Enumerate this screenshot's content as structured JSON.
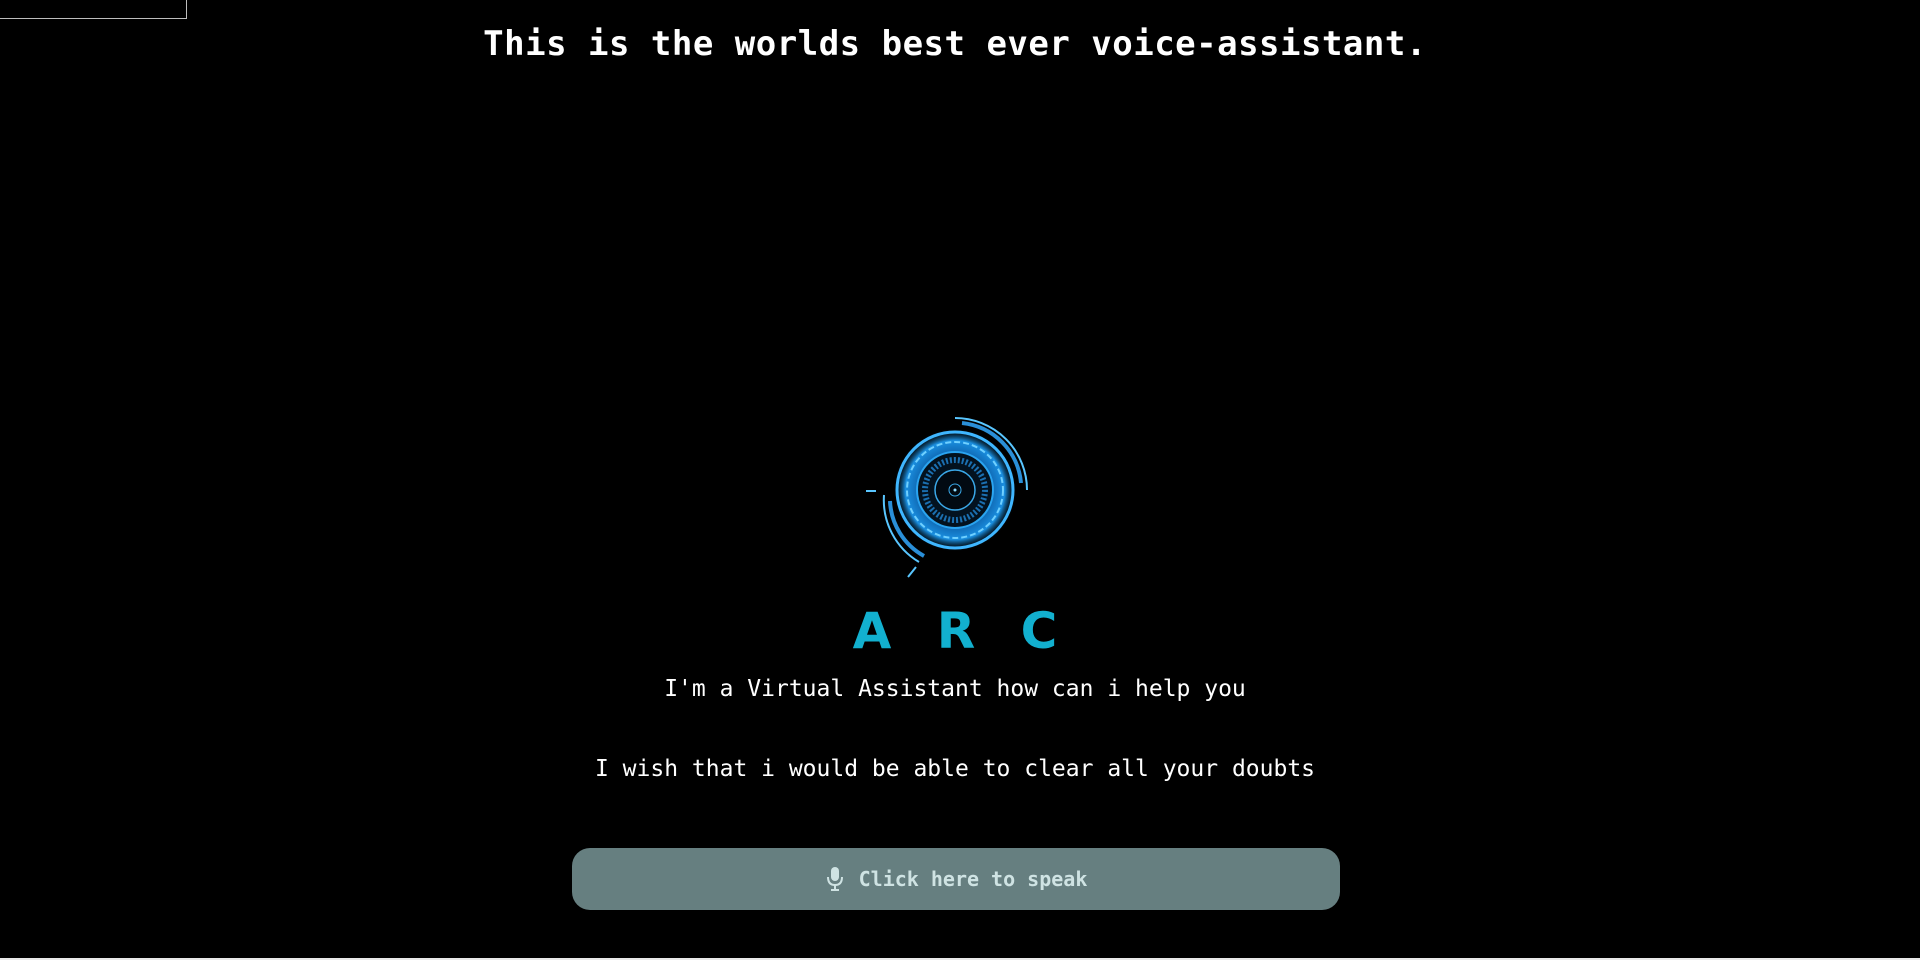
{
  "header": {
    "headline": "This is the worlds best ever voice-assistant."
  },
  "assistant": {
    "logo_icon": "arc-reactor-icon",
    "name": "A R C",
    "intro": "I'm a Virtual Assistant how can i help you",
    "wish": "I wish that i would be able to clear all your doubts"
  },
  "speak_button": {
    "icon": "microphone-icon",
    "label": "Click here to speak"
  },
  "colors": {
    "background": "#000000",
    "accent": "#12b0cf",
    "button_bg": "#667f80",
    "text": "#ffffff"
  }
}
